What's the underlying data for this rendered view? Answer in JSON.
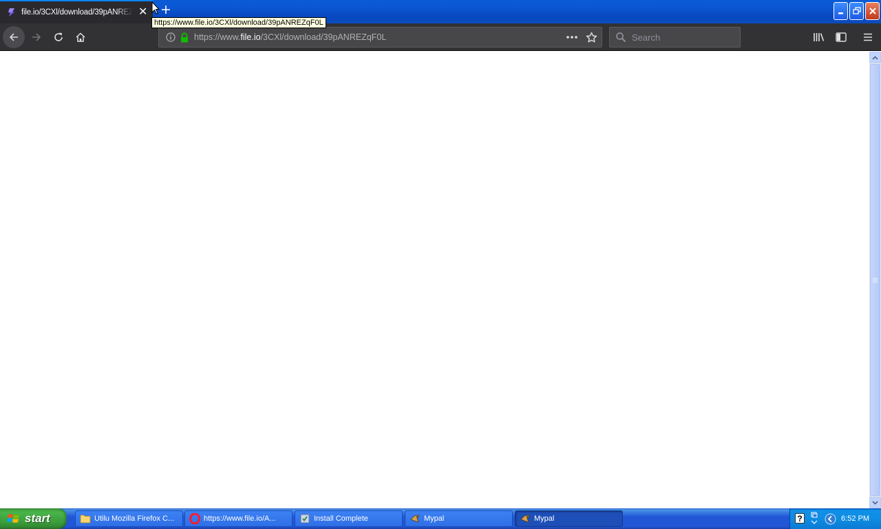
{
  "browser": {
    "tab": {
      "title": "file.io/3CXl/download/39pANREZqF0L",
      "favicon": "file-io-favicon",
      "close_icon": "close-icon"
    },
    "new_tab_icon": "plus-icon",
    "tooltip": "https://www.file.io/3CXl/download/39pANREZqF0L",
    "url": {
      "prefix": "https://www.",
      "domain": "file.io",
      "path": "/3CXl/download/39pANREZqF0L"
    },
    "search": {
      "placeholder": "Search"
    },
    "window_controls": [
      "minimize-icon",
      "restore-icon",
      "close-icon"
    ],
    "colors": {
      "titlebar": "#0a5ad6",
      "toolbar": "#323234",
      "tab_accent": "#0a84ff",
      "secure_lock": "#12bc00"
    }
  },
  "taskbar": {
    "start_label": "start",
    "tasks": [
      {
        "label": "Utilu Mozilla Firefox C...",
        "icon": "folder-icon",
        "active": false
      },
      {
        "label": "https://www.file.io/A...",
        "icon": "opera-icon",
        "active": false
      },
      {
        "label": "Install Complete",
        "icon": "installer-icon",
        "active": false
      },
      {
        "label": "Mypal",
        "icon": "mypal-icon",
        "active": false
      },
      {
        "label": "Mypal",
        "icon": "mypal-icon",
        "active": true
      }
    ],
    "tray_icons": [
      "help-icon",
      "network-icon",
      "expand-tray-icon"
    ],
    "clock": "6:52 PM"
  }
}
